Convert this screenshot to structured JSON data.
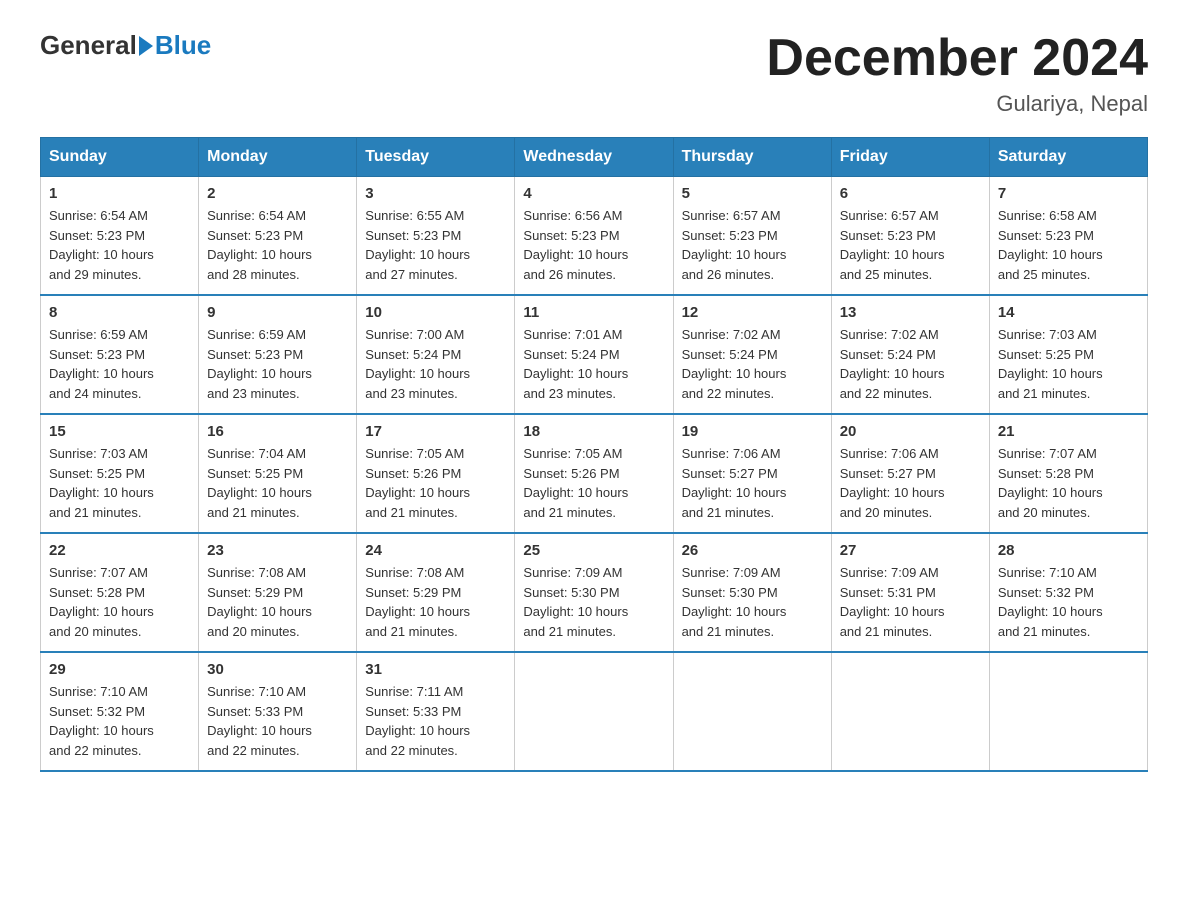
{
  "header": {
    "logo_general": "General",
    "logo_blue": "Blue",
    "title": "December 2024",
    "location": "Gulariya, Nepal"
  },
  "weekdays": [
    "Sunday",
    "Monday",
    "Tuesday",
    "Wednesday",
    "Thursday",
    "Friday",
    "Saturday"
  ],
  "weeks": [
    [
      {
        "day": "1",
        "sunrise": "6:54 AM",
        "sunset": "5:23 PM",
        "daylight": "10 hours and 29 minutes."
      },
      {
        "day": "2",
        "sunrise": "6:54 AM",
        "sunset": "5:23 PM",
        "daylight": "10 hours and 28 minutes."
      },
      {
        "day": "3",
        "sunrise": "6:55 AM",
        "sunset": "5:23 PM",
        "daylight": "10 hours and 27 minutes."
      },
      {
        "day": "4",
        "sunrise": "6:56 AM",
        "sunset": "5:23 PM",
        "daylight": "10 hours and 26 minutes."
      },
      {
        "day": "5",
        "sunrise": "6:57 AM",
        "sunset": "5:23 PM",
        "daylight": "10 hours and 26 minutes."
      },
      {
        "day": "6",
        "sunrise": "6:57 AM",
        "sunset": "5:23 PM",
        "daylight": "10 hours and 25 minutes."
      },
      {
        "day": "7",
        "sunrise": "6:58 AM",
        "sunset": "5:23 PM",
        "daylight": "10 hours and 25 minutes."
      }
    ],
    [
      {
        "day": "8",
        "sunrise": "6:59 AM",
        "sunset": "5:23 PM",
        "daylight": "10 hours and 24 minutes."
      },
      {
        "day": "9",
        "sunrise": "6:59 AM",
        "sunset": "5:23 PM",
        "daylight": "10 hours and 23 minutes."
      },
      {
        "day": "10",
        "sunrise": "7:00 AM",
        "sunset": "5:24 PM",
        "daylight": "10 hours and 23 minutes."
      },
      {
        "day": "11",
        "sunrise": "7:01 AM",
        "sunset": "5:24 PM",
        "daylight": "10 hours and 23 minutes."
      },
      {
        "day": "12",
        "sunrise": "7:02 AM",
        "sunset": "5:24 PM",
        "daylight": "10 hours and 22 minutes."
      },
      {
        "day": "13",
        "sunrise": "7:02 AM",
        "sunset": "5:24 PM",
        "daylight": "10 hours and 22 minutes."
      },
      {
        "day": "14",
        "sunrise": "7:03 AM",
        "sunset": "5:25 PM",
        "daylight": "10 hours and 21 minutes."
      }
    ],
    [
      {
        "day": "15",
        "sunrise": "7:03 AM",
        "sunset": "5:25 PM",
        "daylight": "10 hours and 21 minutes."
      },
      {
        "day": "16",
        "sunrise": "7:04 AM",
        "sunset": "5:25 PM",
        "daylight": "10 hours and 21 minutes."
      },
      {
        "day": "17",
        "sunrise": "7:05 AM",
        "sunset": "5:26 PM",
        "daylight": "10 hours and 21 minutes."
      },
      {
        "day": "18",
        "sunrise": "7:05 AM",
        "sunset": "5:26 PM",
        "daylight": "10 hours and 21 minutes."
      },
      {
        "day": "19",
        "sunrise": "7:06 AM",
        "sunset": "5:27 PM",
        "daylight": "10 hours and 21 minutes."
      },
      {
        "day": "20",
        "sunrise": "7:06 AM",
        "sunset": "5:27 PM",
        "daylight": "10 hours and 20 minutes."
      },
      {
        "day": "21",
        "sunrise": "7:07 AM",
        "sunset": "5:28 PM",
        "daylight": "10 hours and 20 minutes."
      }
    ],
    [
      {
        "day": "22",
        "sunrise": "7:07 AM",
        "sunset": "5:28 PM",
        "daylight": "10 hours and 20 minutes."
      },
      {
        "day": "23",
        "sunrise": "7:08 AM",
        "sunset": "5:29 PM",
        "daylight": "10 hours and 20 minutes."
      },
      {
        "day": "24",
        "sunrise": "7:08 AM",
        "sunset": "5:29 PM",
        "daylight": "10 hours and 21 minutes."
      },
      {
        "day": "25",
        "sunrise": "7:09 AM",
        "sunset": "5:30 PM",
        "daylight": "10 hours and 21 minutes."
      },
      {
        "day": "26",
        "sunrise": "7:09 AM",
        "sunset": "5:30 PM",
        "daylight": "10 hours and 21 minutes."
      },
      {
        "day": "27",
        "sunrise": "7:09 AM",
        "sunset": "5:31 PM",
        "daylight": "10 hours and 21 minutes."
      },
      {
        "day": "28",
        "sunrise": "7:10 AM",
        "sunset": "5:32 PM",
        "daylight": "10 hours and 21 minutes."
      }
    ],
    [
      {
        "day": "29",
        "sunrise": "7:10 AM",
        "sunset": "5:32 PM",
        "daylight": "10 hours and 22 minutes."
      },
      {
        "day": "30",
        "sunrise": "7:10 AM",
        "sunset": "5:33 PM",
        "daylight": "10 hours and 22 minutes."
      },
      {
        "day": "31",
        "sunrise": "7:11 AM",
        "sunset": "5:33 PM",
        "daylight": "10 hours and 22 minutes."
      },
      null,
      null,
      null,
      null
    ]
  ],
  "labels": {
    "sunrise": "Sunrise:",
    "sunset": "Sunset:",
    "daylight": "Daylight:"
  }
}
